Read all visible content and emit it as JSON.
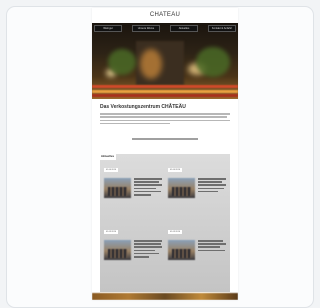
{
  "logo": {
    "text": "CHATEÄU"
  },
  "nav": {
    "items": [
      "Weingut",
      "Unsere Weine",
      "Aktuelles",
      "Kontakt & Anfahrt"
    ]
  },
  "headline": "Das Verkostungszentrum CHÂTEÄU",
  "section": {
    "label": "Aktuelles"
  },
  "news": [
    {
      "date": "01.04.2016"
    },
    {
      "date": "01.04.2016"
    },
    {
      "date": "01.03.2016"
    },
    {
      "date": "01.03.2016"
    }
  ],
  "colors": {
    "grey_panel": "#cfcfcf",
    "page_bg": "#f2f4f6"
  }
}
